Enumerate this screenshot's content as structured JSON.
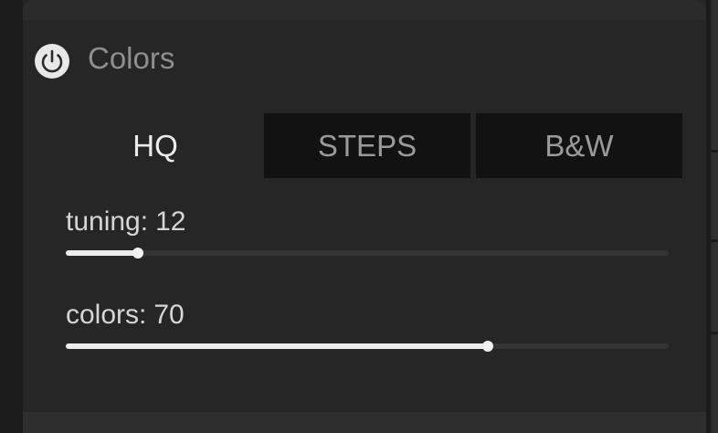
{
  "panel": {
    "title": "Colors",
    "power_icon": "power-icon"
  },
  "tabs": [
    {
      "label": "HQ",
      "active": true
    },
    {
      "label": "STEPS",
      "active": false
    },
    {
      "label": "B&W",
      "active": false
    }
  ],
  "sliders": [
    {
      "label": "tuning:",
      "value": "12",
      "fraction": 0.12
    },
    {
      "label": "colors:",
      "value": "70",
      "fraction": 0.7
    }
  ],
  "colors": {
    "panel_bg": "#262626",
    "inactive_tab_bg": "#121212",
    "active_text": "#ececec",
    "muted_text": "#9a9a9a",
    "slider_fill": "#ececec",
    "slider_track": "#343434"
  }
}
